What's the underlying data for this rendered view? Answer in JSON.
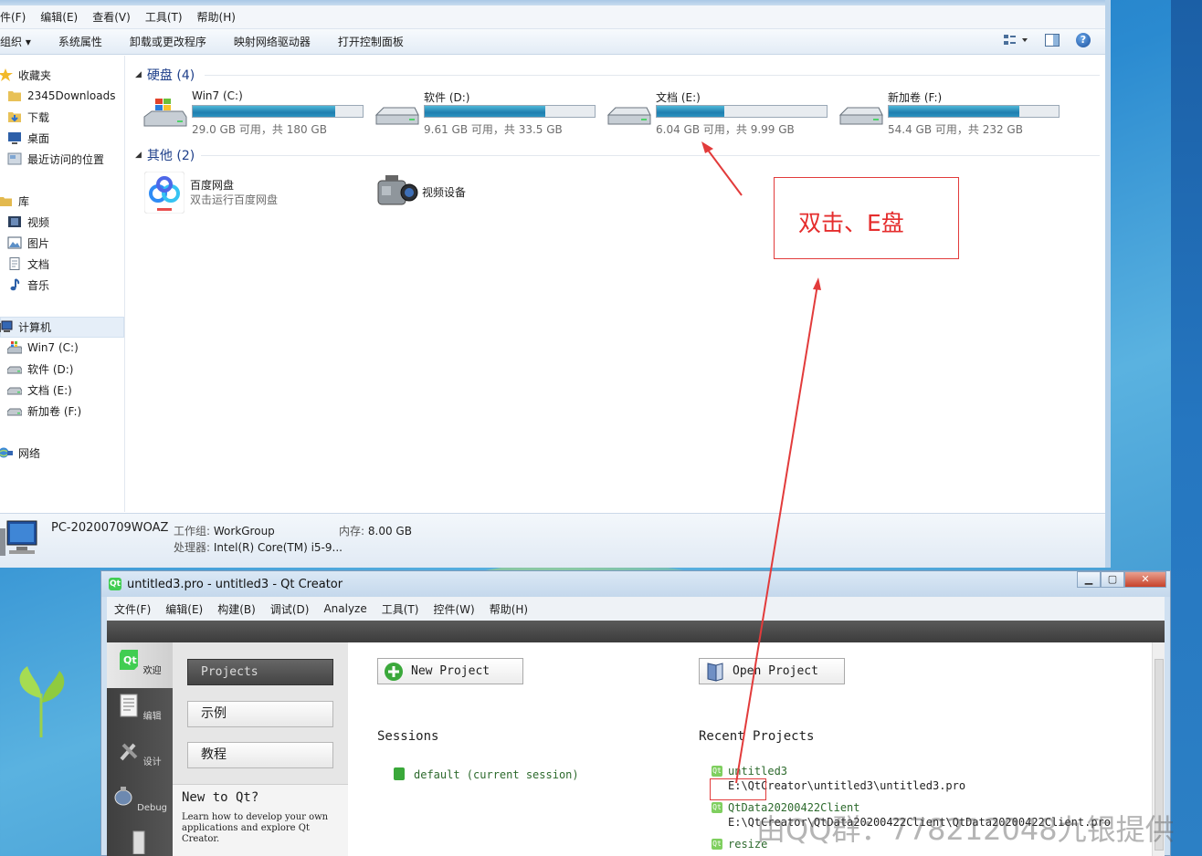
{
  "explorer": {
    "menu": [
      "件(F)",
      "编辑(E)",
      "查看(V)",
      "工具(T)",
      "帮助(H)"
    ],
    "commands": [
      "组织 ▾",
      "系统属性",
      "卸载或更改程序",
      "映射网络驱动器",
      "打开控制面板"
    ],
    "nav": [
      {
        "label": "收藏夹",
        "icon": "star-icon"
      },
      {
        "label": "2345Downloads",
        "icon": "folder-icon"
      },
      {
        "label": "下载",
        "icon": "downloads-folder-icon"
      },
      {
        "label": "桌面",
        "icon": "desktop-icon"
      },
      {
        "label": "最近访问的位置",
        "icon": "recent-places-icon"
      },
      {
        "label": "库",
        "icon": "library-icon"
      },
      {
        "label": "视频",
        "icon": "video-library-icon"
      },
      {
        "label": "图片",
        "icon": "pictures-library-icon"
      },
      {
        "label": "文档",
        "icon": "documents-library-icon"
      },
      {
        "label": "音乐",
        "icon": "music-library-icon"
      },
      {
        "label": "计算机",
        "icon": "computer-icon"
      },
      {
        "label": "Win7 (C:)",
        "icon": "windows-drive-icon"
      },
      {
        "label": "软件 (D:)",
        "icon": "drive-icon"
      },
      {
        "label": "文档 (E:)",
        "icon": "drive-icon"
      },
      {
        "label": "新加卷 (F:)",
        "icon": "drive-icon"
      },
      {
        "label": "网络",
        "icon": "network-icon"
      }
    ],
    "groups": {
      "hard_disks": "硬盘 (4)",
      "other": "其他 (2)"
    },
    "drives": [
      {
        "name": "Win7 (C:)",
        "info": "29.0 GB 可用，共 180 GB",
        "used_fraction": 0.84
      },
      {
        "name": "软件 (D:)",
        "info": "9.61 GB 可用，共 33.5 GB",
        "used_fraction": 0.71
      },
      {
        "name": "文档 (E:)",
        "info": "6.04 GB 可用，共 9.99 GB",
        "used_fraction": 0.4
      },
      {
        "name": "新加卷 (F:)",
        "info": "54.4 GB 可用，共 232 GB",
        "used_fraction": 0.77
      }
    ],
    "others": [
      {
        "name": "百度网盘",
        "sub": "双击运行百度网盘"
      },
      {
        "name": "视频设备",
        "sub": ""
      }
    ],
    "details": {
      "pc_name": "PC-20200709WOAZ",
      "workgroup_label": "工作组:",
      "workgroup": "WorkGroup",
      "memory_label": "内存:",
      "memory": "8.00 GB",
      "cpu_label": "处理器:",
      "cpu": "Intel(R) Core(TM) i5-9..."
    }
  },
  "annotation": {
    "text": "双击、E盘",
    "color": "#e52d2d"
  },
  "qt": {
    "title": "untitled3.pro - untitled3 - Qt Creator",
    "menu": [
      "文件(F)",
      "编辑(E)",
      "构建(B)",
      "调试(D)",
      "Analyze",
      "工具(T)",
      "控件(W)",
      "帮助(H)"
    ],
    "modes": [
      "欢迎",
      "编辑",
      "设计",
      "Debug"
    ],
    "side_buttons": [
      "Projects",
      "示例",
      "教程"
    ],
    "new_to_qt": {
      "heading": "New to Qt?",
      "text": "Learn how to develop your own applications and explore Qt Creator."
    },
    "new_project": "New Project",
    "open_project": "Open Project",
    "sessions_heading": "Sessions",
    "session": "default (current session)",
    "recent_heading": "Recent Projects",
    "recent": [
      {
        "name": "untitled3",
        "path": "E:\\QtCreator\\untitled3\\untitled3.pro"
      },
      {
        "name": "QtData20200422Client",
        "path": "E:\\QtCreator\\QtData20200422Client\\QtData20200422Client.pro"
      },
      {
        "name": "resize",
        "path": ""
      }
    ]
  },
  "watermark": "由QQ群：778212048九银提供"
}
